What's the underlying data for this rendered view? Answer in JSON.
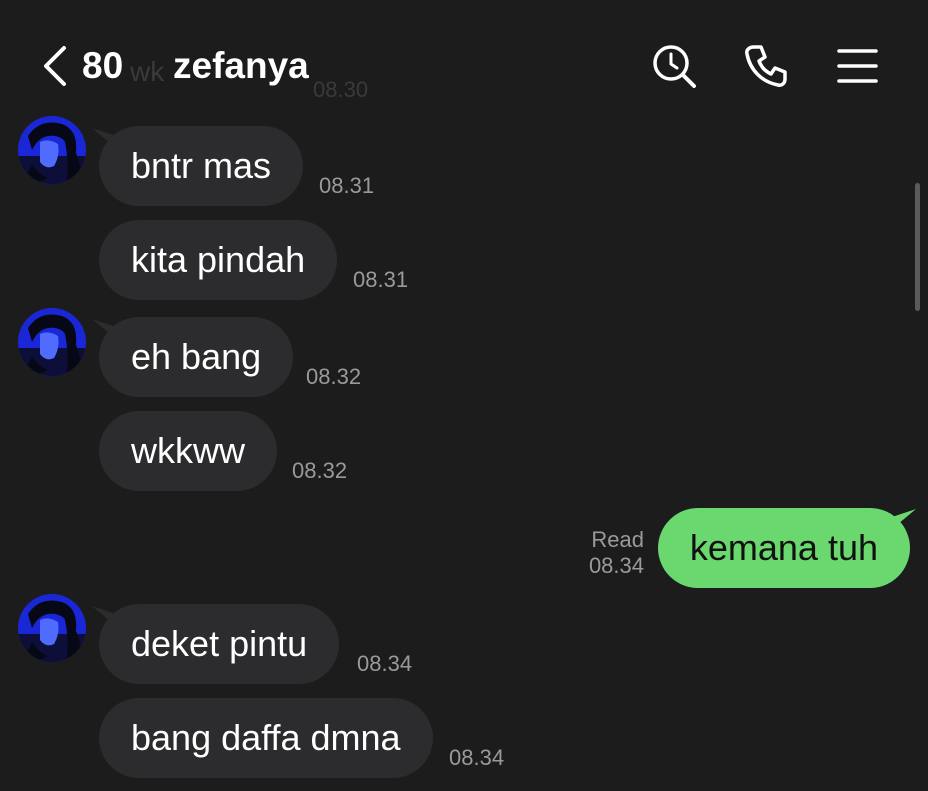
{
  "header": {
    "unread_count": "80",
    "chat_name": "zefanya",
    "ghost_text": "wk",
    "ghost_time": "08.30"
  },
  "icons": {
    "back": "chevron-left-icon",
    "search": "search-icon",
    "call": "phone-icon",
    "menu": "menu-icon"
  },
  "colors": {
    "background": "#1c1c1c",
    "incoming_bubble": "#2c2c2e",
    "outgoing_bubble": "#6ad86e",
    "timestamp": "#9a9a9a"
  },
  "messages": [
    {
      "text": "bntr mas",
      "time": "08.31"
    },
    {
      "text": "kita pindah",
      "time": "08.31"
    },
    {
      "text": "eh bang",
      "time": "08.32"
    },
    {
      "text": "wkkww",
      "time": "08.32"
    },
    {
      "text": "kemana tuh",
      "time": "08.34",
      "status": "Read"
    },
    {
      "text": "deket pintu",
      "time": "08.34"
    },
    {
      "text": "bang daffa dmna",
      "time": "08.34"
    }
  ]
}
